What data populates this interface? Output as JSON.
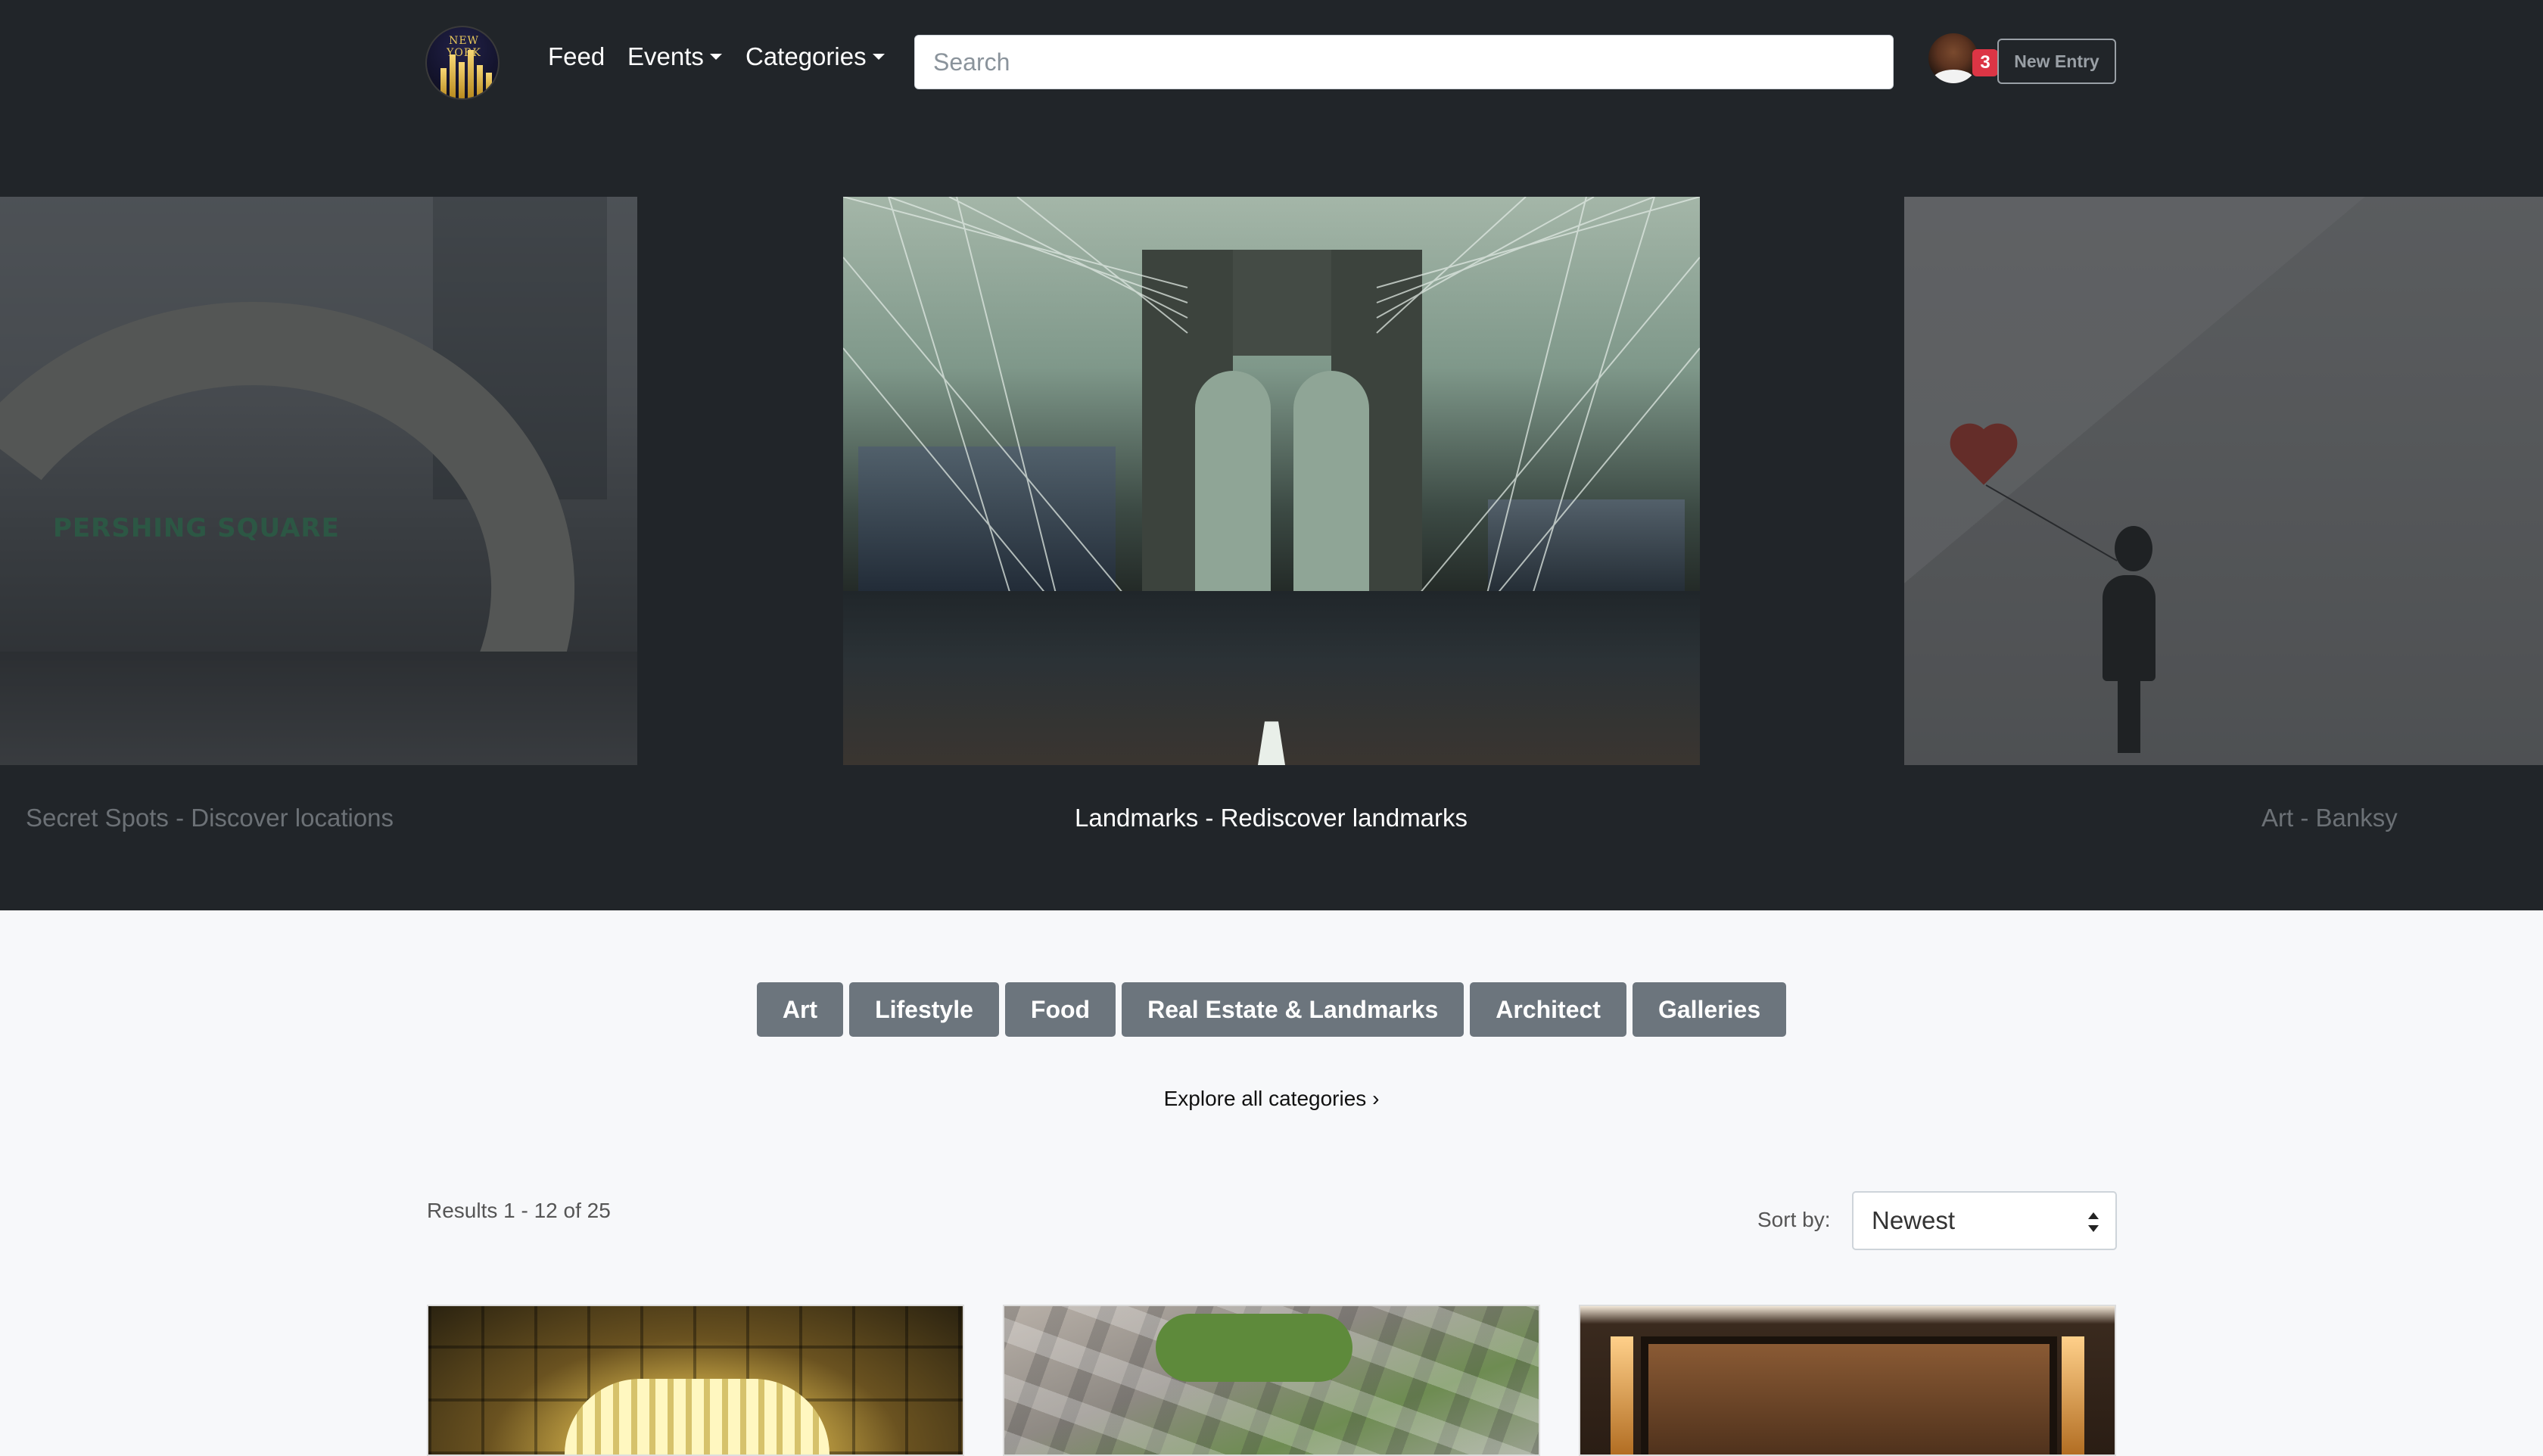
{
  "nav": {
    "logo_text": "NEW YORK",
    "links": [
      {
        "label": "Feed",
        "has_caret": false
      },
      {
        "label": "Events",
        "has_caret": true
      },
      {
        "label": "Categories",
        "has_caret": true
      }
    ],
    "search_placeholder": "Search",
    "notification_count": "3",
    "new_entry_label": "New Entry"
  },
  "carousel": {
    "slides": [
      {
        "caption": "Secret Spots - Discover locations",
        "image": "pershing-square-photo",
        "sign_text": "PERSHING SQUARE",
        "active": false
      },
      {
        "caption": "Landmarks - Rediscover landmarks",
        "image": "brooklyn-bridge-photo",
        "active": true
      },
      {
        "caption": "Art - Banksy",
        "image": "banksy-balloon-girl-photo",
        "active": false
      }
    ]
  },
  "categories": {
    "items": [
      "Art",
      "Lifestyle",
      "Food",
      "Real Estate & Landmarks",
      "Architect",
      "Galleries"
    ],
    "explore_label": "Explore all categories ›"
  },
  "results": {
    "summary": "Results 1 - 12 of 25",
    "sort_label": "Sort by:",
    "sort_value": "Newest"
  },
  "cards": [
    {
      "image": "ornate-ceiling-organ-photo"
    },
    {
      "image": "aerial-houses-photo"
    },
    {
      "image": "wood-paneled-interior-photo"
    }
  ],
  "colors": {
    "hero_bg": "#212529",
    "page_bg": "#f7f8fa",
    "category_button": "#6c757d",
    "badge": "#dc3545"
  }
}
